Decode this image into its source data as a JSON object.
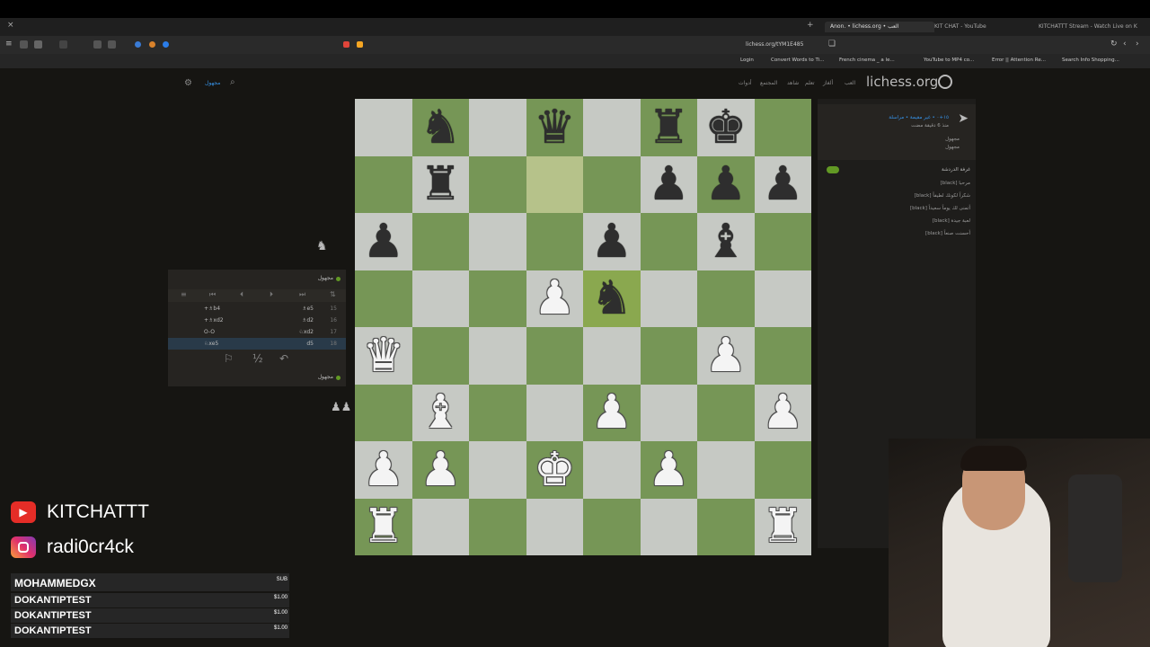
{
  "browser": {
    "tabs": [
      {
        "label": "Anon. • lichess.org • العب",
        "active": true
      },
      {
        "label": "KIT CHAT - YouTube",
        "active": false
      },
      {
        "label": "KITCHATTT Stream - Watch Live on K",
        "active": false
      }
    ],
    "url": "lichess.org/tYM1E485",
    "bookmarks": [
      "Login",
      "Convert Words to Ti...",
      "French cinema _ a le...",
      "YouTube to MP4 co...",
      "Error || Attention Re...",
      "Search Info Shopping..."
    ]
  },
  "site": {
    "logo": "lichess.org",
    "nav": [
      "العب",
      "ألغاز",
      "تعلم",
      "شاهد",
      "المجتمع",
      "أدوات"
    ],
    "search_icon": "search-icon",
    "settings_icon": "gear-icon"
  },
  "board": {
    "ranks": [
      [
        "",
        "bn",
        "",
        "bq",
        "",
        "br",
        "bk",
        ""
      ],
      [
        "",
        "br",
        "",
        "",
        "",
        "bp",
        "bp",
        "bp"
      ],
      [
        "bp",
        "",
        "",
        "",
        "bp",
        "",
        "bb",
        ""
      ],
      [
        "",
        "",
        "",
        "wp",
        "bn",
        "",
        "",
        ""
      ],
      [
        "wq",
        "",
        "",
        "",
        "",
        "",
        "wp",
        ""
      ],
      [
        "",
        "wb",
        "",
        "",
        "wp",
        "",
        "",
        "wp"
      ],
      [
        "wp",
        "wp",
        "",
        "wk",
        "",
        "wp",
        "",
        ""
      ],
      [
        "wr",
        "",
        "",
        "",
        "",
        "",
        "",
        "wr"
      ]
    ],
    "highlight": [
      [
        1,
        3
      ],
      [
        3,
        4
      ]
    ],
    "colors": {
      "light": "#c6c9c4",
      "dark": "#769656"
    }
  },
  "moves": {
    "player_top": "مجهول",
    "player_bottom": "مجهول",
    "rows": [
      {
        "num": "15",
        "white": "♗e5",
        "black": "+♗b4"
      },
      {
        "num": "16",
        "white": "♗d2",
        "black": "+♗xd2"
      },
      {
        "num": "17",
        "white": "♘xd2",
        "black": "O-O"
      },
      {
        "num": "18",
        "white": "d5",
        "black": "♘xe5"
      }
    ],
    "actions": {
      "flag": "⚐",
      "draw": "½",
      "takeback": "↶"
    }
  },
  "chat": {
    "game_info": "١٥+٠ • غير مقيمة • مراسلة",
    "game_sub": "منذ 6 دقيقة مضت",
    "players": [
      "مجهول",
      "مجهول"
    ],
    "title": "غرفة الدردشة",
    "lines": [
      "[black] مرحبا",
      "[black] شكراً لكونك لطيفاً",
      "[black] أتمنى لك يوماً سعيداً",
      "[black] لعبة جيدة",
      "[black] أحسنت صنعاً"
    ]
  },
  "overlay": {
    "youtube": "KITCHATTT",
    "instagram": "radi0cr4ck",
    "events": [
      {
        "name": "MOHAMMEDGX",
        "amount": "SUB"
      },
      {
        "name": "DOKANTIPTEST",
        "amount": "$1.00"
      },
      {
        "name": "DOKANTIPTEST",
        "amount": "$1.00"
      },
      {
        "name": "DOKANTIPTEST",
        "amount": "$1.00"
      }
    ]
  }
}
